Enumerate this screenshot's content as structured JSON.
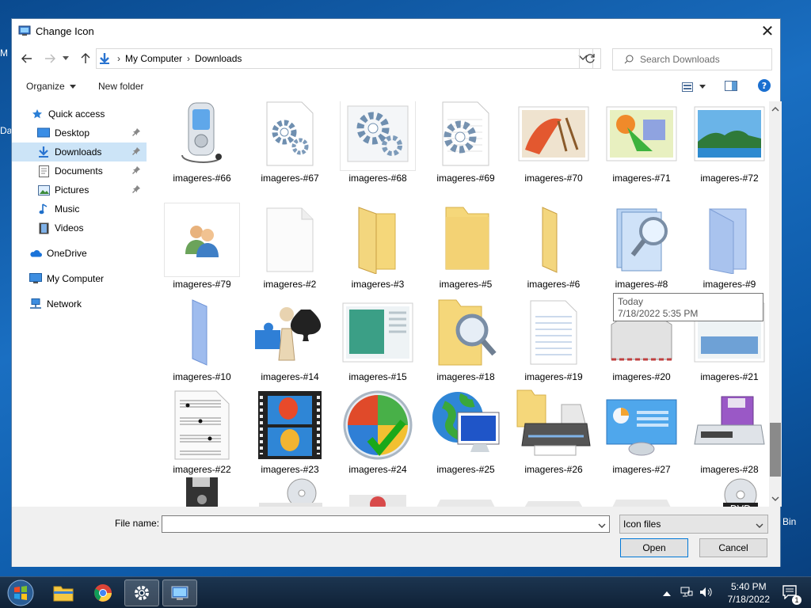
{
  "desktop": {
    "frag_m": "M",
    "frag_da": "Da",
    "frag_bin": "Bin"
  },
  "window": {
    "title": "Change Icon",
    "close": "✕"
  },
  "nav": {
    "breadcrumbs": [
      "My Computer",
      "Downloads"
    ],
    "search_placeholder": "Search Downloads"
  },
  "toolbar": {
    "organize": "Organize",
    "new_folder": "New folder"
  },
  "sidebar": {
    "items": [
      {
        "label": "Quick access",
        "icon": "star-icon"
      },
      {
        "label": "Desktop",
        "icon": "desktop-icon",
        "pinned": true
      },
      {
        "label": "Downloads",
        "icon": "download-icon",
        "pinned": true,
        "selected": true
      },
      {
        "label": "Documents",
        "icon": "documents-icon",
        "pinned": true
      },
      {
        "label": "Pictures",
        "icon": "pictures-icon",
        "pinned": true
      },
      {
        "label": "Music",
        "icon": "music-icon"
      },
      {
        "label": "Videos",
        "icon": "videos-icon"
      },
      {
        "label": "OneDrive",
        "icon": "cloud-icon"
      },
      {
        "label": "My Computer",
        "icon": "computer-icon"
      },
      {
        "label": "Network",
        "icon": "network-icon"
      }
    ]
  },
  "icons": {
    "row1": [
      "imageres-#66",
      "imageres-#67",
      "imageres-#68",
      "imageres-#69",
      "imageres-#70",
      "imageres-#71",
      "imageres-#72"
    ],
    "row2": [
      "imageres-#79",
      "imageres-#2",
      "imageres-#3",
      "imageres-#5",
      "imageres-#6",
      "imageres-#8",
      "imageres-#9"
    ],
    "row3": [
      "imageres-#10",
      "imageres-#14",
      "imageres-#15",
      "imageres-#18",
      "imageres-#19",
      "imageres-#20",
      "imageres-#21"
    ],
    "row4": [
      "imageres-#22",
      "imageres-#23",
      "imageres-#24",
      "imageres-#25",
      "imageres-#26",
      "imageres-#27",
      "imageres-#28"
    ]
  },
  "tooltip": {
    "line1": "Today",
    "line2": "7/18/2022 5:35 PM"
  },
  "bottom": {
    "file_name_label": "File name:",
    "file_name_value": "",
    "file_type": "Icon files",
    "open": "Open",
    "cancel": "Cancel"
  },
  "taskbar": {
    "time": "5:40 PM",
    "date": "7/18/2022",
    "notifications": "1"
  },
  "colors": {
    "accent": "#0078d7",
    "selected": "#cce4f7",
    "folder": "#f5d77a"
  }
}
